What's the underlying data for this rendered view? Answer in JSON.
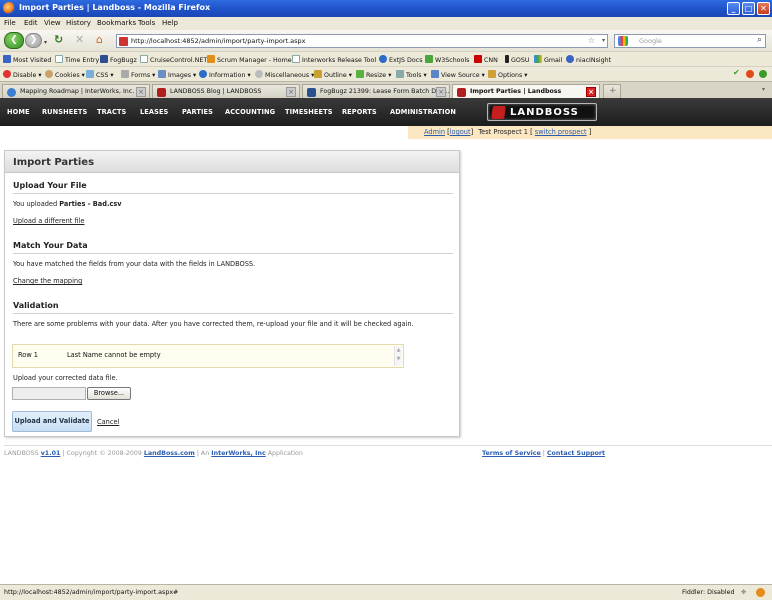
{
  "window": {
    "title": "Import Parties | Landboss - Mozilla Firefox"
  },
  "menu": [
    "File",
    "Edit",
    "View",
    "History",
    "Bookmarks",
    "Tools",
    "Help"
  ],
  "browser": {
    "url": "http://localhost:4852/admin/import/party-import.aspx",
    "search_placeholder": "Google"
  },
  "bookmarks": [
    "Most Visited",
    "Time Entry",
    "FogBugz",
    "CruiseControl.NET",
    "Scrum Manager - Home",
    "Interworks Release Tool",
    "ExtJS Docs",
    "W3Schools",
    "CNN",
    "GOSU",
    "Gmail",
    "niacINsight"
  ],
  "devtools": [
    "Disable",
    "Cookies",
    "CSS",
    "Forms",
    "Images",
    "Information",
    "Miscellaneous",
    "Outline",
    "Resize",
    "Tools",
    "View Source",
    "Options"
  ],
  "tabs": [
    "Mapping Roadmap | InterWorks, Inc.",
    "LANDBOSS Blog | LANDBOSS",
    "FogBugz 21399: Lease Form Batch Doc...",
    "Import Parties | Landboss"
  ],
  "sitenav": [
    "HOME",
    "RUNSHEETS",
    "TRACTS",
    "LEASES",
    "PARTIES",
    "ACCOUNTING",
    "TIMESHEETS",
    "REPORTS",
    "ADMINISTRATION"
  ],
  "logo_text": "LANDBOSS",
  "admin": {
    "user": "Admin",
    "logout": "logout",
    "prospect": "Test Prospect 1",
    "switch": "switch prospect"
  },
  "panel": {
    "title": "Import Parties",
    "upload_heading": "Upload Your File",
    "uploaded_prefix": "You uploaded",
    "uploaded_file": "Parties - Bad.csv",
    "upload_different": "Upload a different file",
    "match_heading": "Match Your Data",
    "match_text": "You have matched the fields from your data with the fields in LANDBOSS.",
    "change_mapping": "Change the mapping",
    "validation_heading": "Validation",
    "validation_text": "There are some problems with your data. After you have corrected them, re-upload your file and it will be checked again.",
    "errors": [
      {
        "row": "Row 1",
        "message": "Last Name cannot be empty"
      }
    ],
    "corrected_label": "Upload your corrected data file.",
    "browse": "Browse...",
    "upload_validate": "Upload and Validate",
    "cancel": "Cancel"
  },
  "footer": {
    "brand": "LANDBOSS",
    "version": "v1.01",
    "copyright": "| Copyright © 2008-2009",
    "site": "LandBoss.com",
    "an": "| An",
    "company": "InterWorks, Inc",
    "application": "Application",
    "terms": "Terms of Service",
    "contact": "Contact Support"
  },
  "status": {
    "url": "http://localhost:4852/admin/import/party-import.aspx#",
    "fiddler": "Fiddler: Disabled"
  }
}
